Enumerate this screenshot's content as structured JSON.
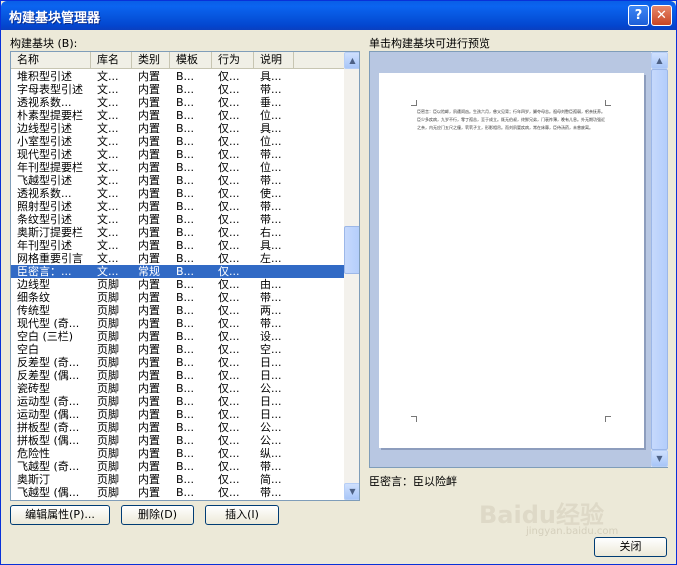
{
  "window": {
    "title": "构建基块管理器",
    "help_glyph": "?",
    "close_glyph": "✕"
  },
  "left_label": "构建基块 (B):",
  "right_label": "单击构建基块可进行预览",
  "columns": [
    "名称",
    "库名",
    "类别",
    "模板",
    "行为",
    "说明"
  ],
  "rows": [
    [
      "堆积型引述",
      "文...",
      "内置",
      "B...",
      "仅...",
      "具..."
    ],
    [
      "字母表型引述",
      "文...",
      "内置",
      "B...",
      "仅...",
      "带..."
    ],
    [
      "透视系数...",
      "文...",
      "内置",
      "B...",
      "仅...",
      "垂..."
    ],
    [
      "朴素型提要栏",
      "文...",
      "内置",
      "B...",
      "仅...",
      "位..."
    ],
    [
      "边线型引述",
      "文...",
      "内置",
      "B...",
      "仅...",
      "具..."
    ],
    [
      "小室型引述",
      "文...",
      "内置",
      "B...",
      "仅...",
      "位..."
    ],
    [
      "现代型引述",
      "文...",
      "内置",
      "B...",
      "仅...",
      "带..."
    ],
    [
      "年刊型提要栏",
      "文...",
      "内置",
      "B...",
      "仅...",
      "位..."
    ],
    [
      "飞越型引述",
      "文...",
      "内置",
      "B...",
      "仅...",
      "带..."
    ],
    [
      "透视系数...",
      "文...",
      "内置",
      "B...",
      "仅...",
      "使..."
    ],
    [
      "照射型引述",
      "文...",
      "内置",
      "B...",
      "仅...",
      "带..."
    ],
    [
      "条纹型引述",
      "文...",
      "内置",
      "B...",
      "仅...",
      "带..."
    ],
    [
      "奥斯汀提要栏",
      "文...",
      "内置",
      "B...",
      "仅...",
      "右..."
    ],
    [
      "年刊型引述",
      "文...",
      "内置",
      "B...",
      "仅...",
      "具..."
    ],
    [
      "网格重要引言",
      "文...",
      "内置",
      "B...",
      "仅...",
      "左..."
    ],
    [
      "臣密言：...",
      "文...",
      "常规",
      "B...",
      "仅...",
      ""
    ],
    [
      "边线型",
      "页脚",
      "内置",
      "B...",
      "仅...",
      "由..."
    ],
    [
      "细条纹",
      "页脚",
      "内置",
      "B...",
      "仅...",
      "带..."
    ],
    [
      "传统型",
      "页脚",
      "内置",
      "B...",
      "仅...",
      "两..."
    ],
    [
      "现代型 (奇...",
      "页脚",
      "内置",
      "B...",
      "仅...",
      "带..."
    ],
    [
      " 空白 (三栏)",
      "页脚",
      "内置",
      "B...",
      "仅...",
      "设..."
    ],
    [
      " 空白",
      "页脚",
      "内置",
      "B...",
      "仅...",
      "空..."
    ],
    [
      "反差型 (奇...",
      "页脚",
      "内置",
      "B...",
      "仅...",
      "日..."
    ],
    [
      "反差型 (偶...",
      "页脚",
      "内置",
      "B...",
      "仅...",
      "日..."
    ],
    [
      "瓷砖型",
      "页脚",
      "内置",
      "B...",
      "仅...",
      "公..."
    ],
    [
      "运动型 (奇...",
      "页脚",
      "内置",
      "B...",
      "仅...",
      "日..."
    ],
    [
      "运动型 (偶...",
      "页脚",
      "内置",
      "B...",
      "仅...",
      "日..."
    ],
    [
      "拼板型 (奇...",
      "页脚",
      "内置",
      "B...",
      "仅...",
      "公..."
    ],
    [
      "拼板型 (偶...",
      "页脚",
      "内置",
      "B...",
      "仅...",
      "公..."
    ],
    [
      "危险性",
      "页脚",
      "内置",
      "B...",
      "仅...",
      "纵..."
    ],
    [
      "飞越型 (奇...",
      "页脚",
      "内置",
      "B...",
      "仅...",
      "带..."
    ],
    [
      "奥斯汀",
      "页脚",
      "内置",
      "B...",
      "仅...",
      "简..."
    ],
    [
      "飞越型 (偶...",
      "页脚",
      "内置",
      "B...",
      "仅...",
      "带..."
    ]
  ],
  "selected_row": 15,
  "list_scroll_fraction": 0.43,
  "buttons": {
    "edit": "编辑属性(P)...",
    "delete": "删除(D)",
    "insert": "插入(I)",
    "close": "关闭"
  },
  "preview": {
    "page_text": "臣密言：臣以险衅，夙遭闵凶。生孩六月，慈父见背；行年四岁，舅夺母志。祖母刘愍臣孤弱，躬亲抚养。臣少多疾病，九岁不行，零丁孤苦，至于成立。既无伯叔，终鲜兄弟，门衰祚薄，晚有儿息。外无期功强近之亲，内无应门五尺之僮，茕茕孑立，形影相吊。而刘夙婴疾病，常在床蓐，臣侍汤药，未曾废离。",
    "caption": "臣密言：臣以险衅"
  },
  "watermark": {
    "main": "Baidu经验",
    "sub": "jingyan.baidu.com"
  }
}
